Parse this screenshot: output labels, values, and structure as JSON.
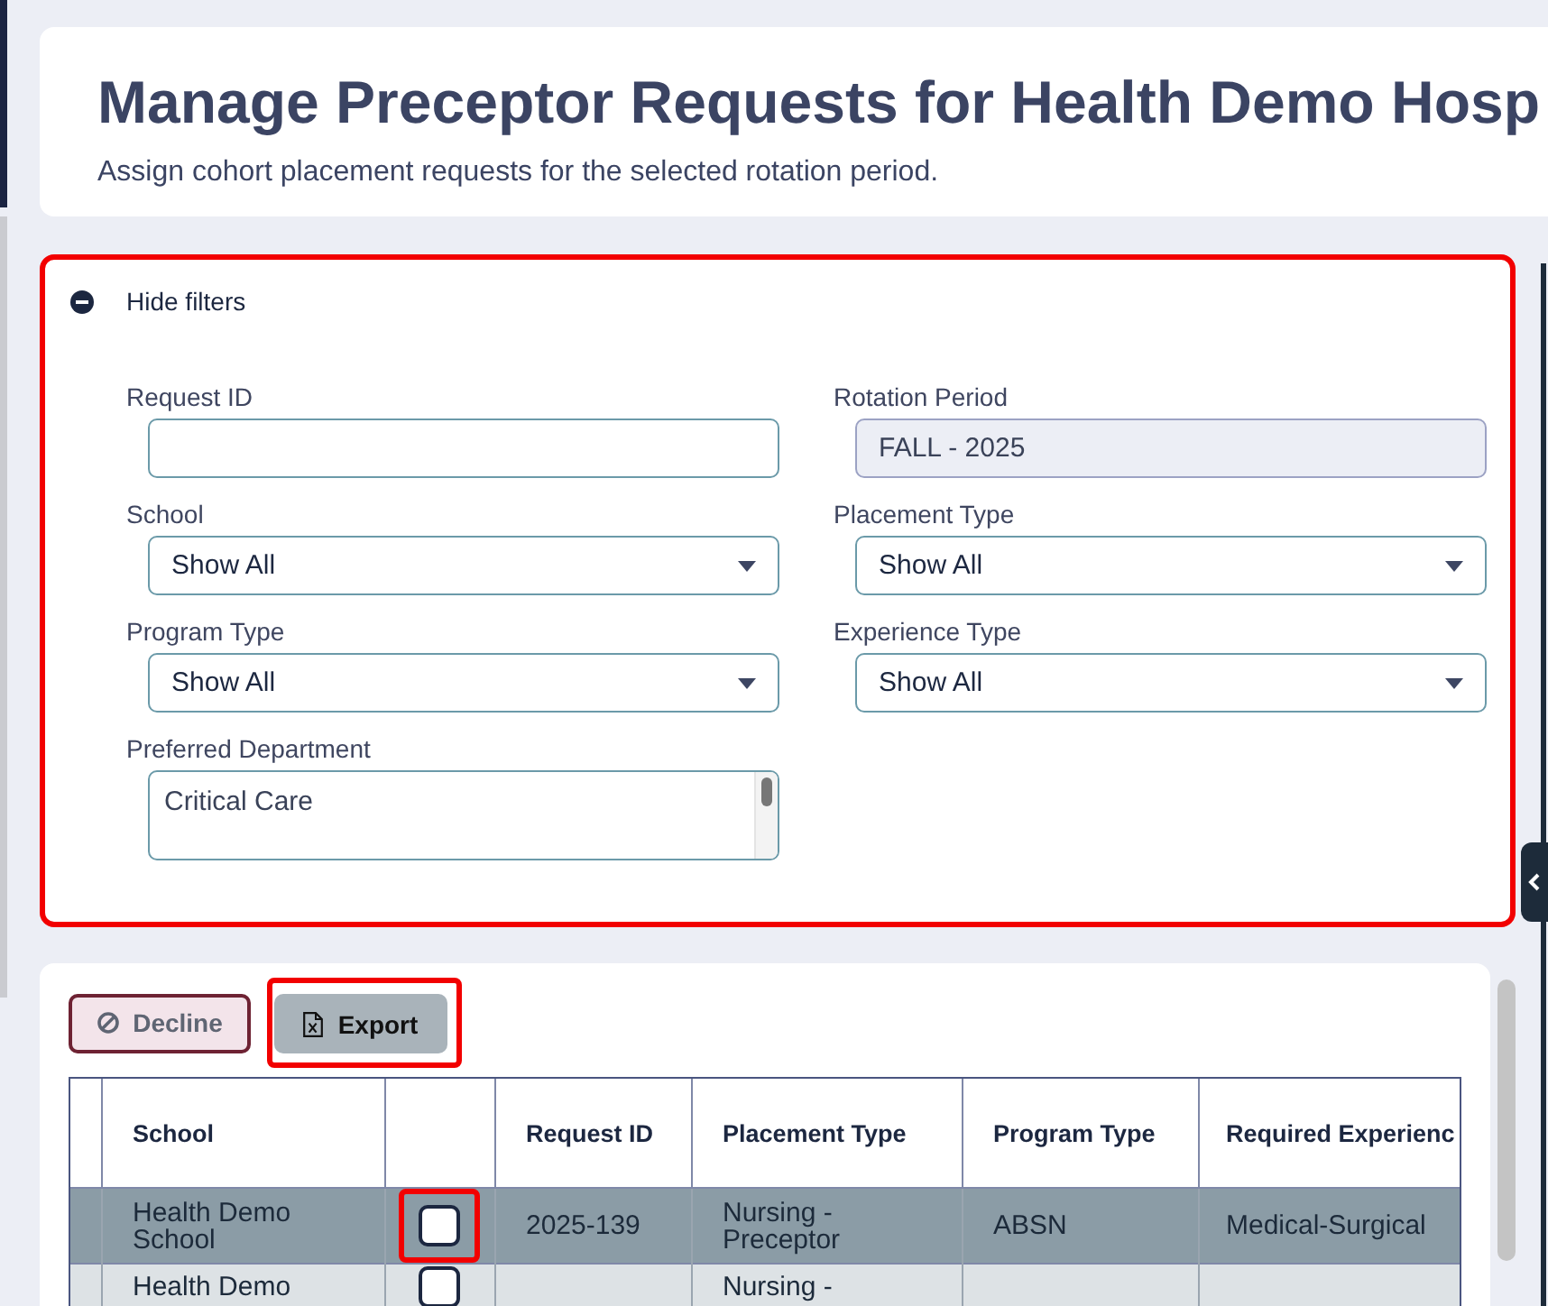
{
  "header": {
    "title": "Manage Preceptor Requests for Health Demo Hosp",
    "subtitle": "Assign cohort placement requests for the selected rotation period."
  },
  "filters": {
    "toggle_label": "Hide filters",
    "expanded": true,
    "highlighted": true,
    "fields": [
      {
        "kind": "text",
        "label": "Request ID",
        "disabled": false
      },
      {
        "kind": "text",
        "label": "Rotation Period",
        "value": "FALL - 2025",
        "disabled": true
      },
      {
        "kind": "select",
        "label": "School",
        "value": "Show All"
      },
      {
        "kind": "select",
        "label": "Placement Type",
        "value": "Show All"
      },
      {
        "kind": "select",
        "label": "Program Type",
        "value": "Show All"
      },
      {
        "kind": "select",
        "label": "Experience Type",
        "value": "Show All"
      },
      {
        "kind": "listbox",
        "label": "Preferred Department",
        "options": [
          "Critical Care"
        ]
      }
    ]
  },
  "toolbar": {
    "buttons": [
      {
        "kind": "decline",
        "label": "Decline",
        "disabled": true,
        "highlighted": false
      },
      {
        "kind": "export",
        "label": "Export",
        "disabled": false,
        "highlighted": true
      }
    ]
  },
  "table": {
    "columns": [
      "School",
      "Request ID",
      "Placement Type",
      "Program Type",
      "Required Experienc"
    ],
    "rows": [
      {
        "selected": true,
        "checked": false,
        "highlighted": true,
        "school": "Health Demo School",
        "request_id": "2025-139",
        "placement_type": "Nursing - Preceptor",
        "program_type": "ABSN",
        "column_7": "Medical-Surgical"
      },
      {
        "selected": false,
        "checked": false,
        "highlighted": false,
        "school": "Health Demo",
        "placement_type": "Nursing -"
      }
    ]
  }
}
